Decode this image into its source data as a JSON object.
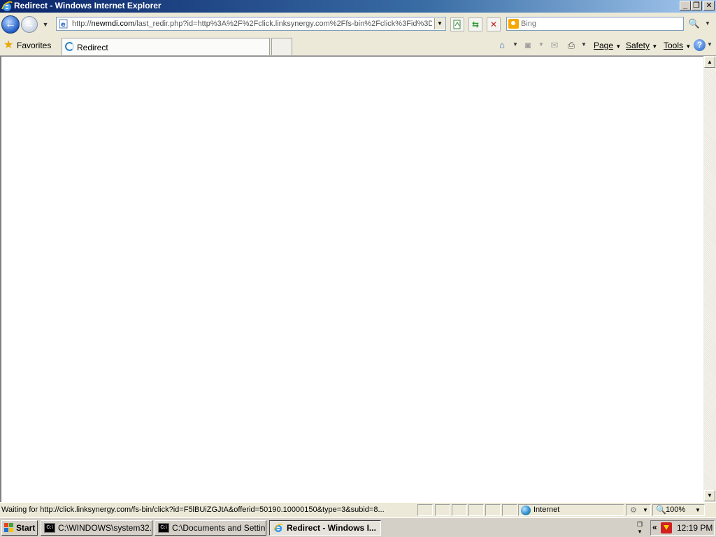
{
  "window": {
    "title": "Redirect - Windows Internet Explorer",
    "minimize_glyph": "_",
    "restore_glyph": "❐",
    "close_glyph": "✕"
  },
  "nav": {
    "url_prefix": "http://",
    "url_domain": "newmdi.com",
    "url_rest": "/last_redir.php?id=http%3A%2F%2Fclick.linksynergy.com%2Ffs-bin%2Fclick%3Fid%3D",
    "search_placeholder": "Bing",
    "icons": [
      "back-arrow-icon",
      "forward-arrow-icon",
      "compatibility-view-icon",
      "refresh-icon",
      "stop-icon",
      "search-icon"
    ]
  },
  "toolbar": {
    "favorites_label": "Favorites",
    "tab_title": "Redirect",
    "page_label": "Page",
    "safety_label": "Safety",
    "tools_label": "Tools",
    "help_glyph": "?"
  },
  "status": {
    "text": "Waiting for http://click.linksynergy.com/fs-bin/click?id=F5lBUiZGJtA&offerid=50190.10000150&type=3&subid=8...",
    "zone": "Internet",
    "zoom": "100%"
  },
  "taskbar": {
    "start_label": "Start",
    "items": [
      {
        "label": "C:\\WINDOWS\\system32...",
        "active": false
      },
      {
        "label": "C:\\Documents and Settin...",
        "active": false
      },
      {
        "label": "Redirect - Windows I...",
        "active": true
      }
    ],
    "clock": "12:19 PM",
    "tray_chevron": "«"
  },
  "colors": {
    "titlebar_start": "#0a246a",
    "titlebar_end": "#a6caf0",
    "chrome": "#ece9d8",
    "taskbar": "#d4d0c8"
  }
}
